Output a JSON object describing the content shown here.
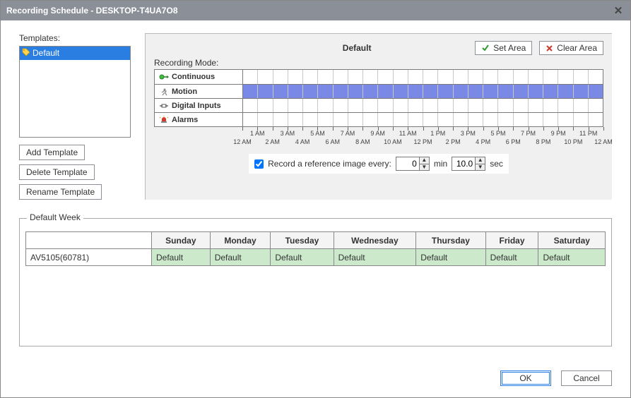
{
  "window": {
    "title": "Recording Schedule - DESKTOP-T4UA7O8"
  },
  "templates": {
    "section_label": "Templates:",
    "items": [
      "Default"
    ],
    "add_label": "Add Template",
    "delete_label": "Delete Template",
    "rename_label": "Rename Template"
  },
  "schedule": {
    "title": "Default",
    "recording_mode_label": "Recording Mode:",
    "set_area_label": "Set Area",
    "clear_area_label": "Clear Area",
    "modes": [
      "Continuous",
      "Motion",
      "Digital Inputs",
      "Alarms"
    ],
    "hours_top": [
      "",
      "1 AM",
      "",
      "3 AM",
      "",
      "5 AM",
      "",
      "7 AM",
      "",
      "9 AM",
      "",
      "11 AM",
      "",
      "1 PM",
      "",
      "3 PM",
      "",
      "5 PM",
      "",
      "7 PM",
      "",
      "9 PM",
      "",
      "11 PM",
      ""
    ],
    "hours_bottom": [
      "12 AM",
      "",
      "2 AM",
      "",
      "4 AM",
      "",
      "6 AM",
      "",
      "8 AM",
      "",
      "10 AM",
      "",
      "12 PM",
      "",
      "2 PM",
      "",
      "4 PM",
      "",
      "6 PM",
      "",
      "8 PM",
      "",
      "10 PM",
      "",
      "12 AM"
    ],
    "ref_label": "Record a reference image every:",
    "ref_min": "0",
    "ref_min_unit": "min",
    "ref_sec": "10.0",
    "ref_sec_unit": "sec"
  },
  "week": {
    "section_label": "Default Week",
    "device": "AV5105(60781)",
    "days": [
      "Sunday",
      "Monday",
      "Tuesday",
      "Wednesday",
      "Thursday",
      "Friday",
      "Saturday"
    ],
    "values": [
      "Default",
      "Default",
      "Default",
      "Default",
      "Default",
      "Default",
      "Default"
    ]
  },
  "footer": {
    "ok": "OK",
    "cancel": "Cancel"
  }
}
